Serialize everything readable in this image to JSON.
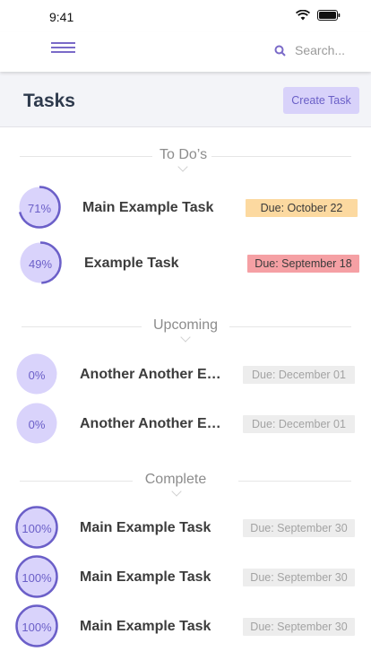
{
  "status_bar": {
    "time": "9:41"
  },
  "search": {
    "placeholder": "Search..."
  },
  "header": {
    "title": "Tasks",
    "create_label": "Create Task"
  },
  "colors": {
    "accent": "#7a6ac8",
    "ring_fill": "#d9d3fb",
    "ring_stroke": "#6b5fc8",
    "due_orange": "#fcd9a0",
    "due_red": "#f5a0a4",
    "due_gray": "#ededed"
  },
  "sections": [
    {
      "label": "To Do’s",
      "tasks": [
        {
          "progress": 71,
          "progress_label": "71%",
          "name": "Main Example Task",
          "due": "Due: October 22",
          "status": "orange"
        },
        {
          "progress": 49,
          "progress_label": "49%",
          "name": "Example Task",
          "due": "Due: September 18",
          "status": "red"
        }
      ]
    },
    {
      "label": "Upcoming",
      "tasks": [
        {
          "progress": 0,
          "progress_label": "0%",
          "name": "Another Another Exa...",
          "due": "Due: December 01",
          "status": "gray"
        },
        {
          "progress": 0,
          "progress_label": "0%",
          "name": "Another Another Exa...",
          "due": "Due: December 01",
          "status": "gray"
        }
      ]
    },
    {
      "label": "Complete",
      "tasks": [
        {
          "progress": 100,
          "progress_label": "100%",
          "name": "Main Example Task",
          "due": "Due: September 30",
          "status": "gray"
        },
        {
          "progress": 100,
          "progress_label": "100%",
          "name": "Main Example Task",
          "due": "Due: September 30",
          "status": "gray"
        },
        {
          "progress": 100,
          "progress_label": "100%",
          "name": "Main Example Task",
          "due": "Due: September 30",
          "status": "gray"
        }
      ]
    }
  ]
}
